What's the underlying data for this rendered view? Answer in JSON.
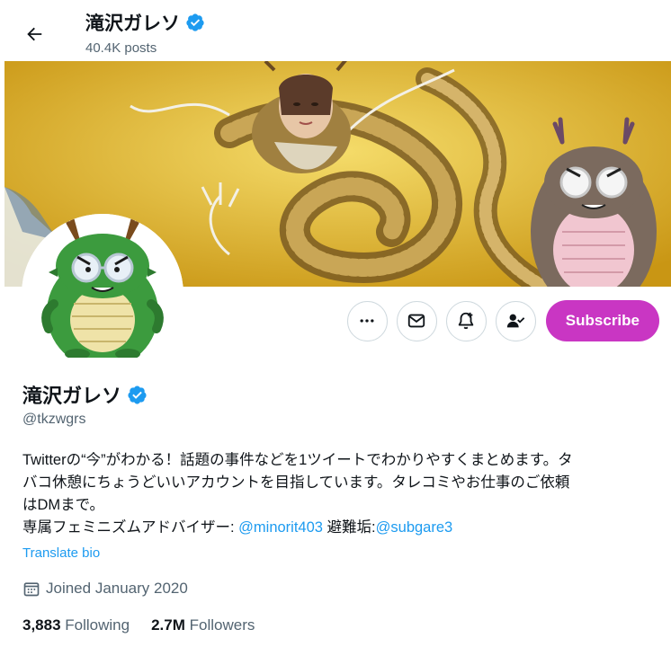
{
  "header": {
    "display_name": "滝沢ガレソ",
    "posts_count": "40.4K posts"
  },
  "actions": {
    "subscribe_label": "Subscribe"
  },
  "profile": {
    "display_name": "滝沢ガレソ",
    "handle": "@tkzwgrs",
    "bio_line1": "Twitterの“今”がわかる！話題の事件などを1ツイートでわかりやすくまとめます。タ",
    "bio_line2": "バコ休憩にちょうどいいアカウントを目指しています。タレコミやお仕事のご依頼",
    "bio_line3": "はDMまで。",
    "bio_line4_prefix": "専属フェミニズムアドバイザー: ",
    "bio_mention1": "@minorit403",
    "bio_line4_middle": " 避難垢:",
    "bio_mention2": "@subgare3",
    "translate_label": "Translate bio",
    "joined": "Joined January 2020",
    "following_count": "3,883",
    "following_label": "Following",
    "followers_count": "2.7M",
    "followers_label": "Followers"
  },
  "colors": {
    "subscribe_bg": "#c936c3",
    "link": "#1d9bf0",
    "verified": "#1d9bf0",
    "secondary_text": "#536471"
  }
}
